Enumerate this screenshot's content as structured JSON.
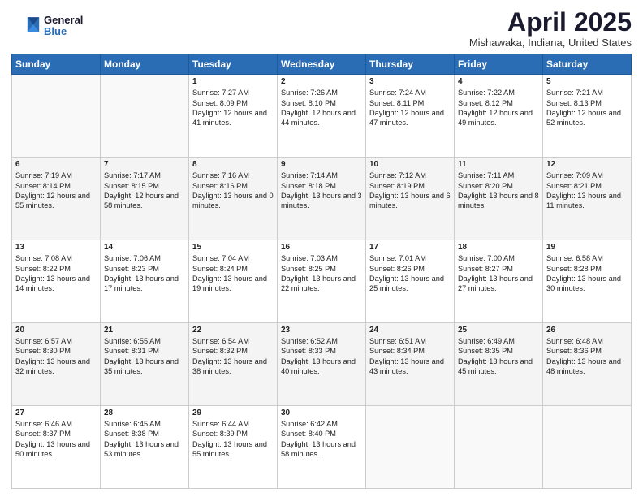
{
  "logo": {
    "general": "General",
    "blue": "Blue"
  },
  "title": "April 2025",
  "location": "Mishawaka, Indiana, United States",
  "weekdays": [
    "Sunday",
    "Monday",
    "Tuesday",
    "Wednesday",
    "Thursday",
    "Friday",
    "Saturday"
  ],
  "weeks": [
    [
      {
        "day": "",
        "empty": true
      },
      {
        "day": "",
        "empty": true
      },
      {
        "day": "1",
        "sunrise": "Sunrise: 7:27 AM",
        "sunset": "Sunset: 8:09 PM",
        "daylight": "Daylight: 12 hours and 41 minutes."
      },
      {
        "day": "2",
        "sunrise": "Sunrise: 7:26 AM",
        "sunset": "Sunset: 8:10 PM",
        "daylight": "Daylight: 12 hours and 44 minutes."
      },
      {
        "day": "3",
        "sunrise": "Sunrise: 7:24 AM",
        "sunset": "Sunset: 8:11 PM",
        "daylight": "Daylight: 12 hours and 47 minutes."
      },
      {
        "day": "4",
        "sunrise": "Sunrise: 7:22 AM",
        "sunset": "Sunset: 8:12 PM",
        "daylight": "Daylight: 12 hours and 49 minutes."
      },
      {
        "day": "5",
        "sunrise": "Sunrise: 7:21 AM",
        "sunset": "Sunset: 8:13 PM",
        "daylight": "Daylight: 12 hours and 52 minutes."
      }
    ],
    [
      {
        "day": "6",
        "sunrise": "Sunrise: 7:19 AM",
        "sunset": "Sunset: 8:14 PM",
        "daylight": "Daylight: 12 hours and 55 minutes."
      },
      {
        "day": "7",
        "sunrise": "Sunrise: 7:17 AM",
        "sunset": "Sunset: 8:15 PM",
        "daylight": "Daylight: 12 hours and 58 minutes."
      },
      {
        "day": "8",
        "sunrise": "Sunrise: 7:16 AM",
        "sunset": "Sunset: 8:16 PM",
        "daylight": "Daylight: 13 hours and 0 minutes."
      },
      {
        "day": "9",
        "sunrise": "Sunrise: 7:14 AM",
        "sunset": "Sunset: 8:18 PM",
        "daylight": "Daylight: 13 hours and 3 minutes."
      },
      {
        "day": "10",
        "sunrise": "Sunrise: 7:12 AM",
        "sunset": "Sunset: 8:19 PM",
        "daylight": "Daylight: 13 hours and 6 minutes."
      },
      {
        "day": "11",
        "sunrise": "Sunrise: 7:11 AM",
        "sunset": "Sunset: 8:20 PM",
        "daylight": "Daylight: 13 hours and 8 minutes."
      },
      {
        "day": "12",
        "sunrise": "Sunrise: 7:09 AM",
        "sunset": "Sunset: 8:21 PM",
        "daylight": "Daylight: 13 hours and 11 minutes."
      }
    ],
    [
      {
        "day": "13",
        "sunrise": "Sunrise: 7:08 AM",
        "sunset": "Sunset: 8:22 PM",
        "daylight": "Daylight: 13 hours and 14 minutes."
      },
      {
        "day": "14",
        "sunrise": "Sunrise: 7:06 AM",
        "sunset": "Sunset: 8:23 PM",
        "daylight": "Daylight: 13 hours and 17 minutes."
      },
      {
        "day": "15",
        "sunrise": "Sunrise: 7:04 AM",
        "sunset": "Sunset: 8:24 PM",
        "daylight": "Daylight: 13 hours and 19 minutes."
      },
      {
        "day": "16",
        "sunrise": "Sunrise: 7:03 AM",
        "sunset": "Sunset: 8:25 PM",
        "daylight": "Daylight: 13 hours and 22 minutes."
      },
      {
        "day": "17",
        "sunrise": "Sunrise: 7:01 AM",
        "sunset": "Sunset: 8:26 PM",
        "daylight": "Daylight: 13 hours and 25 minutes."
      },
      {
        "day": "18",
        "sunrise": "Sunrise: 7:00 AM",
        "sunset": "Sunset: 8:27 PM",
        "daylight": "Daylight: 13 hours and 27 minutes."
      },
      {
        "day": "19",
        "sunrise": "Sunrise: 6:58 AM",
        "sunset": "Sunset: 8:28 PM",
        "daylight": "Daylight: 13 hours and 30 minutes."
      }
    ],
    [
      {
        "day": "20",
        "sunrise": "Sunrise: 6:57 AM",
        "sunset": "Sunset: 8:30 PM",
        "daylight": "Daylight: 13 hours and 32 minutes."
      },
      {
        "day": "21",
        "sunrise": "Sunrise: 6:55 AM",
        "sunset": "Sunset: 8:31 PM",
        "daylight": "Daylight: 13 hours and 35 minutes."
      },
      {
        "day": "22",
        "sunrise": "Sunrise: 6:54 AM",
        "sunset": "Sunset: 8:32 PM",
        "daylight": "Daylight: 13 hours and 38 minutes."
      },
      {
        "day": "23",
        "sunrise": "Sunrise: 6:52 AM",
        "sunset": "Sunset: 8:33 PM",
        "daylight": "Daylight: 13 hours and 40 minutes."
      },
      {
        "day": "24",
        "sunrise": "Sunrise: 6:51 AM",
        "sunset": "Sunset: 8:34 PM",
        "daylight": "Daylight: 13 hours and 43 minutes."
      },
      {
        "day": "25",
        "sunrise": "Sunrise: 6:49 AM",
        "sunset": "Sunset: 8:35 PM",
        "daylight": "Daylight: 13 hours and 45 minutes."
      },
      {
        "day": "26",
        "sunrise": "Sunrise: 6:48 AM",
        "sunset": "Sunset: 8:36 PM",
        "daylight": "Daylight: 13 hours and 48 minutes."
      }
    ],
    [
      {
        "day": "27",
        "sunrise": "Sunrise: 6:46 AM",
        "sunset": "Sunset: 8:37 PM",
        "daylight": "Daylight: 13 hours and 50 minutes."
      },
      {
        "day": "28",
        "sunrise": "Sunrise: 6:45 AM",
        "sunset": "Sunset: 8:38 PM",
        "daylight": "Daylight: 13 hours and 53 minutes."
      },
      {
        "day": "29",
        "sunrise": "Sunrise: 6:44 AM",
        "sunset": "Sunset: 8:39 PM",
        "daylight": "Daylight: 13 hours and 55 minutes."
      },
      {
        "day": "30",
        "sunrise": "Sunrise: 6:42 AM",
        "sunset": "Sunset: 8:40 PM",
        "daylight": "Daylight: 13 hours and 58 minutes."
      },
      {
        "day": "",
        "empty": true
      },
      {
        "day": "",
        "empty": true
      },
      {
        "day": "",
        "empty": true
      }
    ]
  ]
}
